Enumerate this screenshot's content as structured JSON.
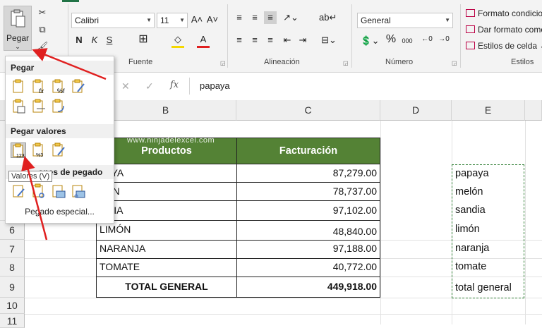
{
  "ribbon": {
    "paste_label": "Pegar",
    "font_name": "Calibri",
    "font_size": "11",
    "number_format": "General",
    "bold": "N",
    "italic": "K",
    "underline": "S",
    "percent": "%",
    "thousands": "000",
    "groups": {
      "fuente": "Fuente",
      "alineacion": "Alineación",
      "numero": "Número",
      "estilos": "Estilos"
    },
    "styles": {
      "conditional": "Formato condicio",
      "as_table": "Dar formato como",
      "cell_styles": "Estilos de celda"
    }
  },
  "formula_bar": {
    "content": "papaya",
    "fx": "fx"
  },
  "columns": [
    "B",
    "C",
    "D",
    "E"
  ],
  "rows": [
    "6",
    "7",
    "8",
    "9",
    "10",
    "11"
  ],
  "table": {
    "header_product": "Productos",
    "header_billing": "Facturación",
    "rows": [
      {
        "name": "PAYA",
        "value": "87,279.00"
      },
      {
        "name": "LÓN",
        "value": "78,737.00"
      },
      {
        "name": "NDIA",
        "value": "97,102.00"
      },
      {
        "name": "LIMÓN",
        "value": "48,840.00"
      },
      {
        "name": "NARANJA",
        "value": "97,188.00"
      },
      {
        "name": "TOMATE",
        "value": "40,772.00"
      }
    ],
    "total_label": "TOTAL GENERAL",
    "total_value": "449,918.00"
  },
  "pasted_list": [
    "papaya",
    "melón",
    "sandia",
    "limón",
    "naranja",
    "tomate",
    "total general"
  ],
  "dropdown": {
    "pegar": "Pegar",
    "pegar_valores": "Pegar valores",
    "otras": "ones de pegado",
    "tooltip": "Valores (V)",
    "pegado_especial": "Pegado especial..."
  },
  "watermark": "www.ninjadelexcel.com",
  "colors": {
    "header_green": "#548235",
    "arrow_red": "#e02020",
    "dash_green": "#2e7d32"
  }
}
